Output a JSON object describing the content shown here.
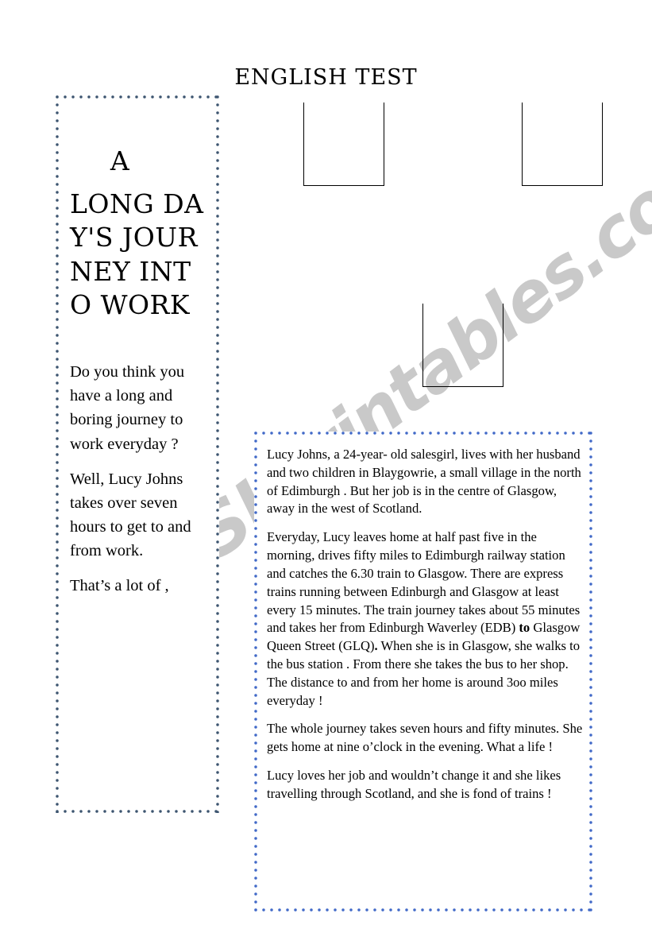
{
  "watermark": {
    "text": "ESLprintables.com",
    "color": "#c9c9c9"
  },
  "header": {
    "title": "ENGLISH TEST"
  },
  "placeholders": [
    {
      "name": "image-placeholder-1"
    },
    {
      "name": "image-placeholder-2"
    },
    {
      "name": "image-placeholder-3"
    }
  ],
  "sidebar": {
    "border_color": "#3d5570",
    "poster_title_lines": [
      "A",
      "LONG",
      "DAY'S",
      "JOURNEY",
      "INTO",
      "WORK"
    ],
    "poster_title_text": "A LONG DAY'S JOURNEY INTO WORK",
    "paragraphs": [
      "Do you think you have a long and boring journey to work everyday ?",
      "Well, Lucy Johns  takes over seven hours to get to and from work.",
      "That’s a lot of ,"
    ]
  },
  "reading_panel": {
    "border_color": "#4169c8",
    "paragraphs": [
      {
        "id": "paragraph-1",
        "text": "Lucy Johns, a 24-year- old salesgirl, lives with her husband and two children in Blaygowrie, a small village in the north of Edimburgh . But her job is in the centre of Glasgow, away in the west of Scotland."
      },
      {
        "id": "paragraph-2-part-a",
        "text": "Everyday, Lucy leaves home at half past five in the morning, drives fifty miles to Edimburgh railway station and catches the 6.30 train to Glasgow. There are express trains running between Edinburgh and Glasgow at least every 15 minutes. The train journey takes about 55 minutes and takes her from Edinburgh Waverley (EDB) "
      },
      {
        "id": "paragraph-2-bold",
        "text": "to"
      },
      {
        "id": "paragraph-2-part-b",
        "text": " Glasgow Queen Street (GLQ)"
      },
      {
        "id": "paragraph-2-bold-2",
        "text": "."
      },
      {
        "id": "paragraph-2-part-c",
        "text": "  When she is in Glasgow, she walks to the bus station . From there she takes the bus to her shop. The distance to and from her home is around 3oo miles everyday !"
      },
      {
        "id": "paragraph-3",
        "text": "The whole journey takes seven hours and fifty minutes. She gets home at nine o’clock in the evening. What a life !"
      },
      {
        "id": "paragraph-4",
        "text": "Lucy loves her job and wouldn’t change it and she likes travelling through Scotland, and she is fond of trains !"
      }
    ]
  }
}
